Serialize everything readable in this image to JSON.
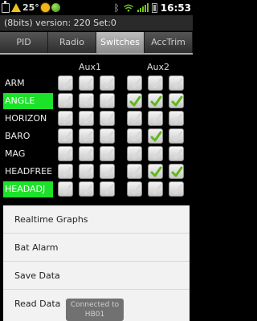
{
  "status_bar": {
    "temperature": "25°",
    "time": "16:53",
    "icons": [
      "usb-icon",
      "warning-icon",
      "sun-icon",
      "ball-icon",
      "bluetooth-icon",
      "wifi-icon",
      "signal-icon",
      "battery-icon"
    ]
  },
  "app": {
    "title": "(8bits) version: 220   Set:0"
  },
  "tabs": [
    "PID",
    "Radio",
    "Switches",
    "AccTrim"
  ],
  "active_tab": "Switches",
  "aux": [
    "Aux1",
    "Aux2"
  ],
  "rows": [
    {
      "label": "ARM",
      "active": false,
      "checks": [
        false,
        false,
        false,
        false,
        false,
        false
      ]
    },
    {
      "label": "ANGLE",
      "active": true,
      "checks": [
        false,
        false,
        false,
        true,
        true,
        true
      ]
    },
    {
      "label": "HORIZON",
      "active": false,
      "checks": [
        false,
        false,
        false,
        false,
        false,
        false
      ]
    },
    {
      "label": "BARO",
      "active": false,
      "checks": [
        false,
        false,
        false,
        false,
        true,
        false
      ]
    },
    {
      "label": "MAG",
      "active": false,
      "checks": [
        false,
        false,
        false,
        false,
        false,
        false
      ]
    },
    {
      "label": "HEADFREE",
      "active": false,
      "checks": [
        false,
        false,
        false,
        false,
        true,
        true
      ]
    },
    {
      "label": "HEADADJ",
      "active": true,
      "checks": [
        false,
        false,
        false,
        false,
        false,
        false
      ]
    }
  ],
  "menu": [
    "Realtime Graphs",
    "Bat Alarm",
    "Save Data",
    "Read Data"
  ],
  "toast": "Connected to HB01",
  "colors": {
    "active_label": "#1de22a",
    "check": "#5fb81d"
  }
}
